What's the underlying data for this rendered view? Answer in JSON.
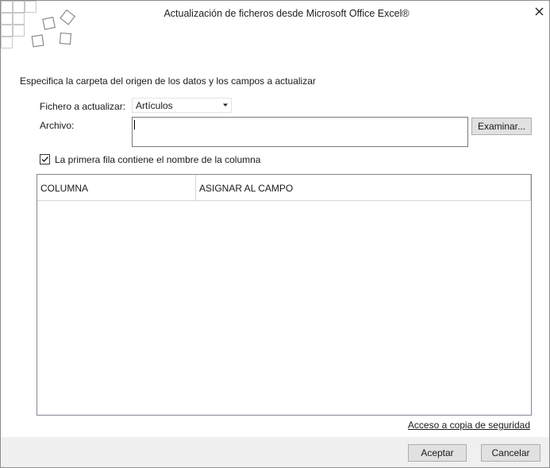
{
  "window": {
    "title": "Actualización de ficheros desde Microsoft Office Excel®",
    "close_icon": "close-icon"
  },
  "form": {
    "instruction": "Especifica la carpeta del origen de los datos y los campos a actualizar",
    "fichero_label": "Fichero a actualizar:",
    "fichero_value": "Artículos",
    "archivo_label": "Archivo:",
    "archivo_value": "",
    "examinar_label": "Examinar...",
    "checkbox_label": "La primera fila contiene el nombre de la columna",
    "checkbox_checked": true
  },
  "grid": {
    "columns": [
      "COLUMNA",
      "ASIGNAR AL CAMPO"
    ],
    "rows": []
  },
  "links": {
    "backup": "Acceso a copia de seguridad"
  },
  "footer": {
    "accept": "Aceptar",
    "cancel": "Cancelar"
  },
  "colors": {
    "border": "#8c8c8c",
    "button_bg": "#e1e1e1",
    "footer_bg": "#f0f0f0"
  }
}
